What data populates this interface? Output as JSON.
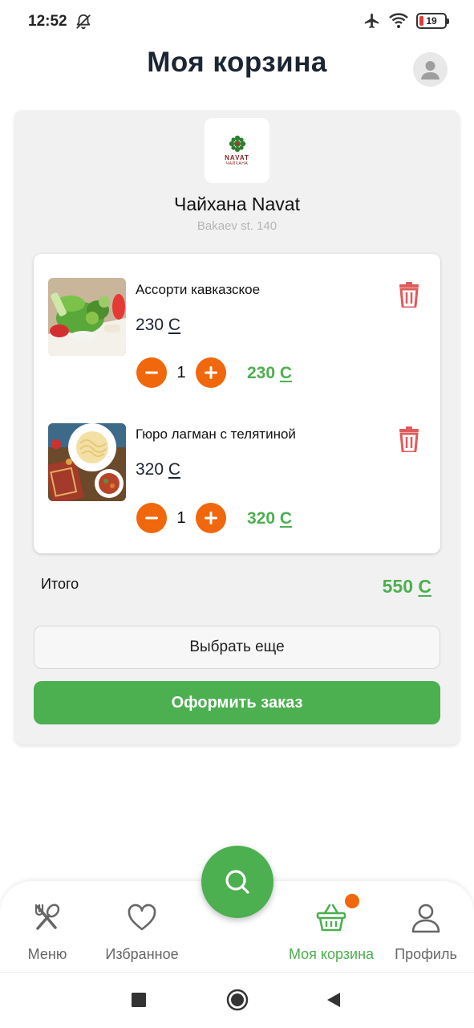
{
  "status_bar": {
    "time": "12:52",
    "battery": "19"
  },
  "header": {
    "title": "Моя корзина"
  },
  "restaurant": {
    "logo_title": "NAVAT",
    "logo_subtitle": "ЧАЙХАНА",
    "name": "Чайхана Navat",
    "address": "Bakaev st. 140"
  },
  "currency": "С",
  "cart_items": [
    {
      "name": "Ассорти кавказское",
      "price": "230",
      "quantity": "1",
      "total": "230"
    },
    {
      "name": "Гюро лагман с телятиной",
      "price": "320",
      "quantity": "1",
      "total": "320"
    }
  ],
  "summary": {
    "total_label": "Итого",
    "total_value": "550"
  },
  "actions": {
    "more_label": "Выбрать еще",
    "order_label": "Оформить заказ"
  },
  "bottom_nav": [
    {
      "label": "Меню",
      "icon": "utensils-icon"
    },
    {
      "label": "Избранное",
      "icon": "heart-icon"
    },
    {
      "label": "Моя корзина",
      "icon": "basket-icon",
      "active": true
    },
    {
      "label": "Профиль",
      "icon": "user-icon"
    }
  ],
  "colors": {
    "accent": "#4caf50",
    "orange": "#f0670c",
    "danger": "#e05a5a"
  }
}
